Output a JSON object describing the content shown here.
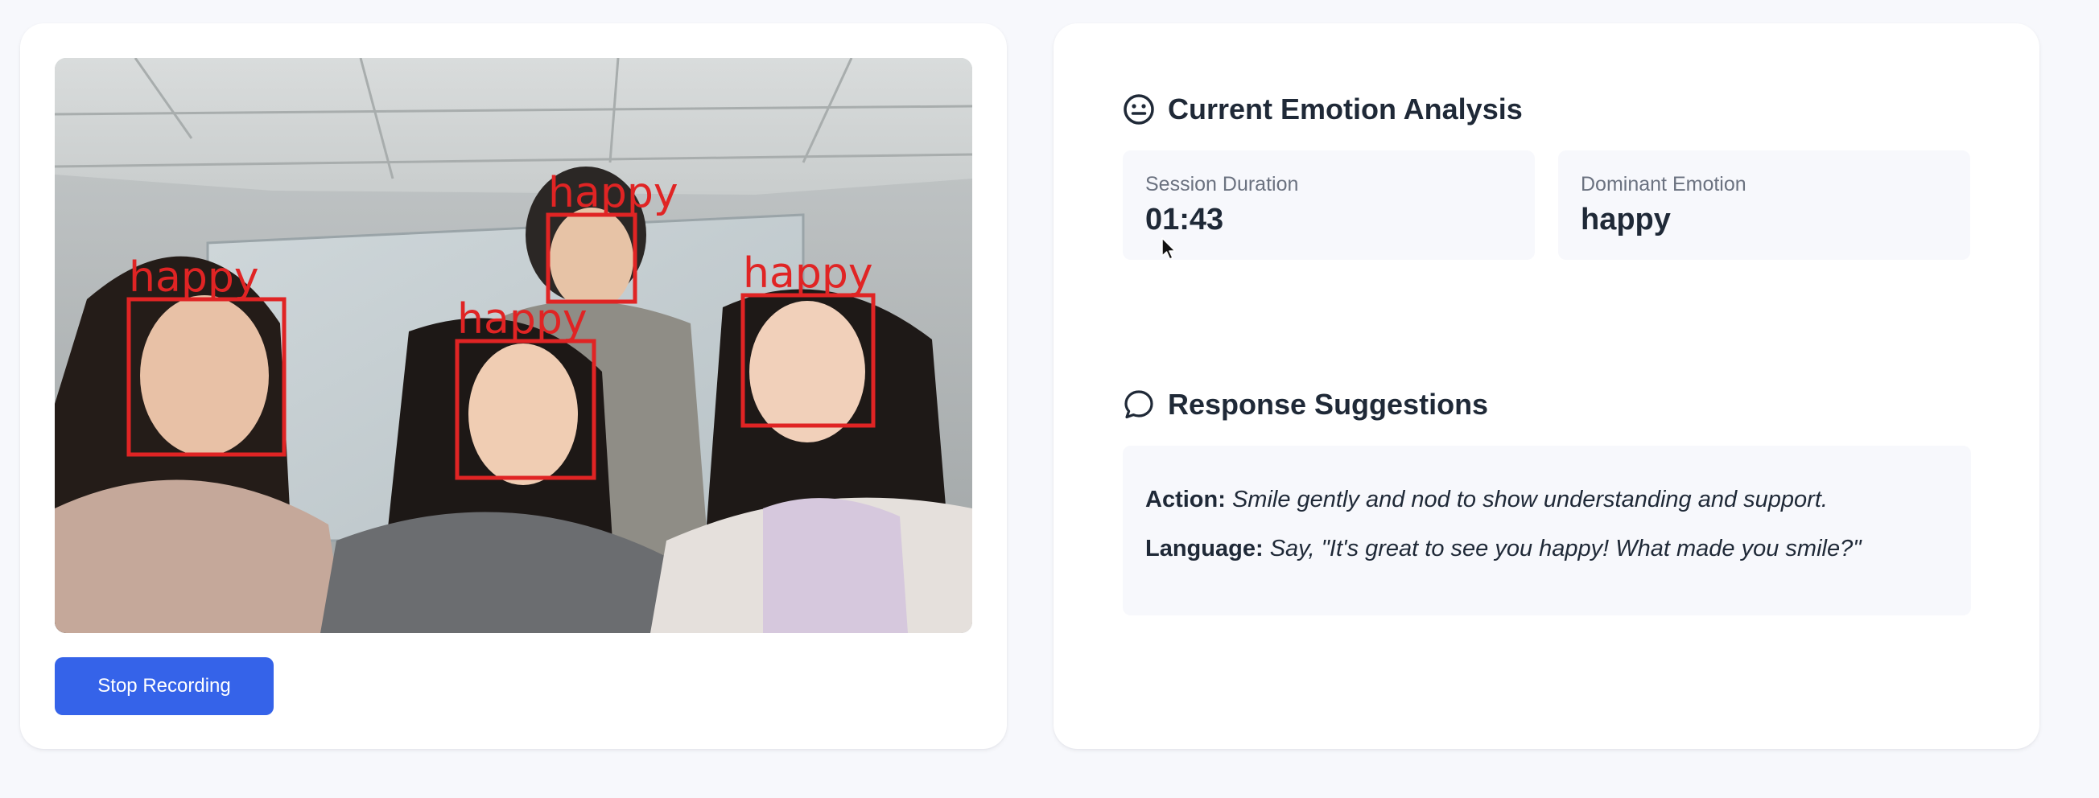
{
  "video": {
    "faces": [
      {
        "label": "happy"
      },
      {
        "label": "happy"
      },
      {
        "label": "happy"
      },
      {
        "label": "happy"
      }
    ],
    "stop_label": "Stop Recording"
  },
  "analysis": {
    "title": "Current Emotion Analysis",
    "session_label": "Session Duration",
    "session_value": "01:43",
    "dominant_label": "Dominant Emotion",
    "dominant_value": "happy"
  },
  "suggestions": {
    "title": "Response Suggestions",
    "action_key": "Action:",
    "action_text": "Smile gently and nod to show understanding and support.",
    "language_key": "Language:",
    "language_text": "Say, \"It's great to see you happy! What made you smile?\""
  },
  "colors": {
    "accent": "#3563e9",
    "face_box": "#e02424",
    "page_bg": "#f7f8fc"
  },
  "icons": {
    "emotion": "face-neutral-icon",
    "suggestions": "chat-bubble-icon"
  }
}
